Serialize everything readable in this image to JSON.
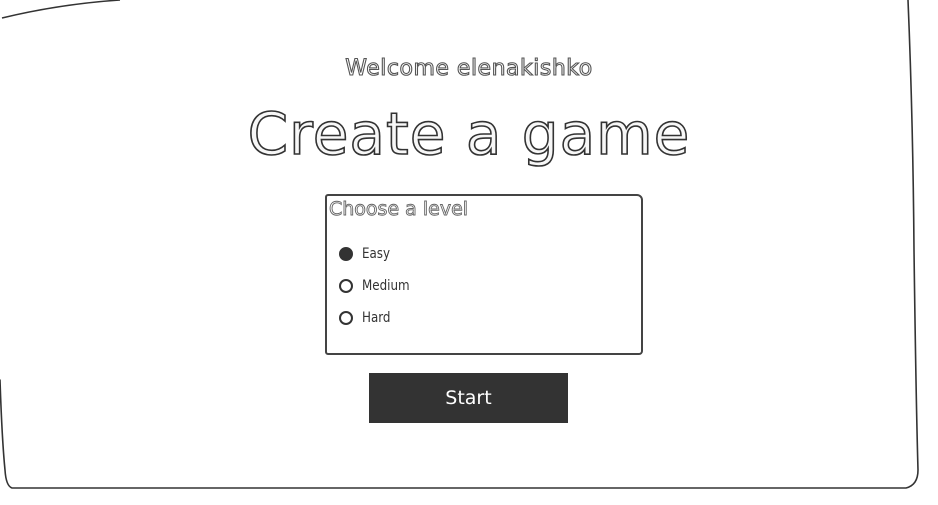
{
  "header": {
    "welcome_prefix": "Welcome",
    "username": "elenakishko",
    "welcome_text": "Welcome elenakishko"
  },
  "main": {
    "title": "Create a game"
  },
  "level_select": {
    "legend": "Choose a level",
    "options": [
      {
        "label": "Easy",
        "checked": true
      },
      {
        "label": "Medium",
        "checked": false
      },
      {
        "label": "Hard",
        "checked": false
      }
    ]
  },
  "actions": {
    "start_label": "Start"
  },
  "colors": {
    "ink": "#333333",
    "background": "#ffffff"
  }
}
